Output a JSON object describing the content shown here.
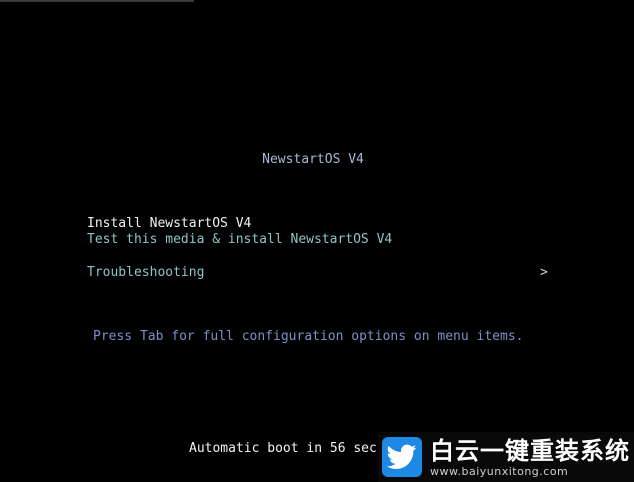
{
  "boot_menu": {
    "title": "NewstartOS V4",
    "items": [
      {
        "label": "Install NewstartOS V4",
        "selected": true
      },
      {
        "label": "Test this media & install NewstartOS V4",
        "selected": false
      },
      {
        "label": "Troubleshooting",
        "selected": false,
        "submenu_indicator": ">"
      }
    ],
    "hint": "Press Tab for full configuration options on menu items.",
    "countdown": "Automatic boot in 56 sec"
  },
  "watermark": {
    "icon": "twitter-bird-icon",
    "brand": "白云一键重装系统",
    "url": "www.baiyunxitong.com"
  },
  "colors": {
    "background": "#000000",
    "selected_text": "#f2f2f2",
    "menu_text": "#8ec4c4",
    "title_text": "#a9b7d6",
    "hint_text": "#7f8fc7",
    "logo": "#1e88e5"
  }
}
